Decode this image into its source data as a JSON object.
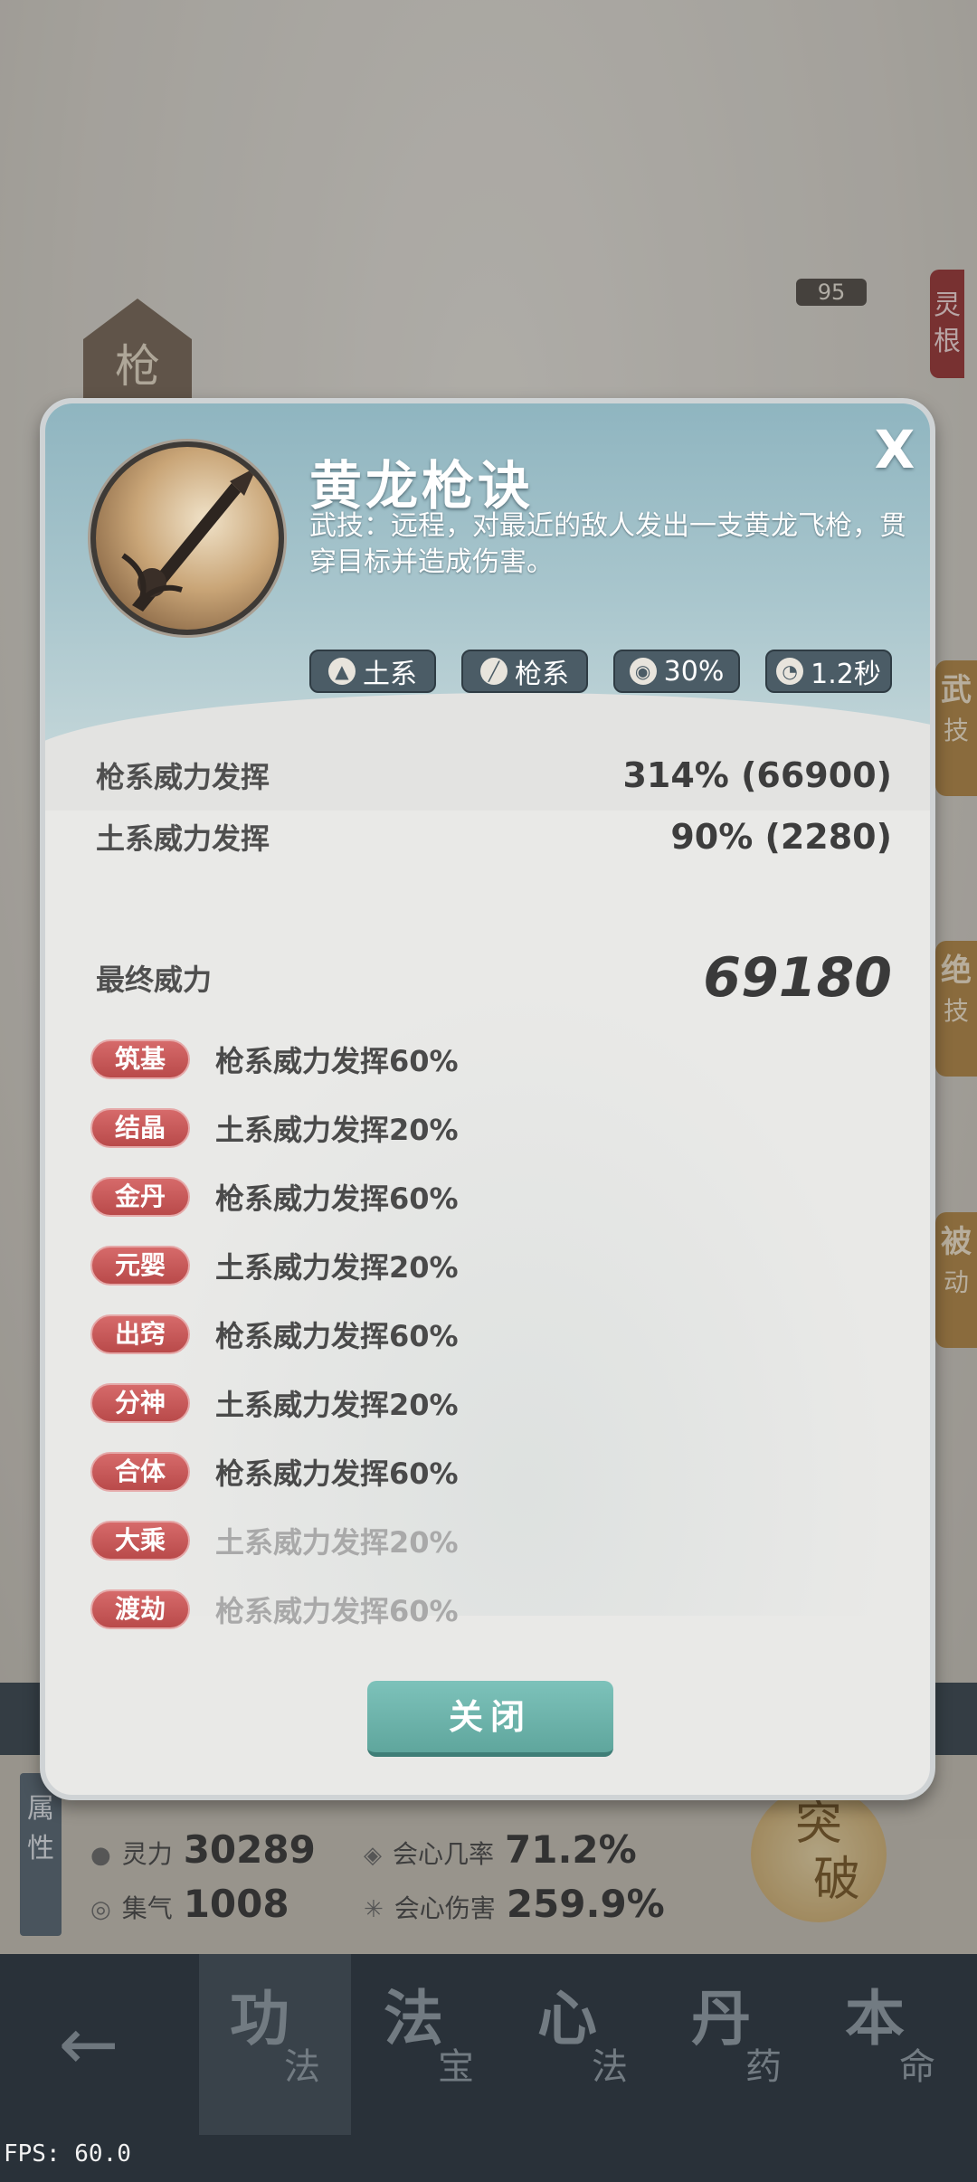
{
  "background": {
    "weapon_badge": "枪",
    "level": "95",
    "linggen": "灵根",
    "side_tabs": [
      {
        "big": "武",
        "small": "技"
      },
      {
        "big": "绝",
        "small": "技"
      },
      {
        "big": "被",
        "small": "动"
      }
    ],
    "attribute_label": "属性",
    "stats": [
      {
        "icon": "droplet-icon",
        "label": "灵力",
        "value": "30289"
      },
      {
        "icon": "swirl-icon",
        "label": "集气",
        "value": "1008"
      },
      {
        "icon": "crit-rate-icon",
        "label": "会心几率",
        "value": "71.2%"
      },
      {
        "icon": "crit-damage-icon",
        "label": "会心伤害",
        "value": "259.9%"
      }
    ],
    "breakthrough": [
      "突",
      "破"
    ],
    "nav": {
      "back": "←",
      "items": [
        {
          "big": "功",
          "small": "法"
        },
        {
          "big": "法",
          "small": "宝"
        },
        {
          "big": "心",
          "small": "法"
        },
        {
          "big": "丹",
          "small": "药"
        },
        {
          "big": "本",
          "small": "命"
        }
      ]
    },
    "fps": "FPS: 60.0"
  },
  "modal": {
    "title": "黄龙枪诀",
    "description": "武技：远程，对最近的敌人发出一支黄龙飞枪，贯穿目标并造成伤害。",
    "close_x": "X",
    "tags": [
      {
        "icon": "earth-icon",
        "label": "土系"
      },
      {
        "icon": "spear-icon",
        "label": "枪系"
      },
      {
        "icon": "spiral-icon",
        "label": "30%"
      },
      {
        "icon": "cooldown-icon",
        "label": "1.2秒"
      }
    ],
    "power_rows": [
      {
        "label": "枪系威力发挥",
        "value": "314% (66900)"
      },
      {
        "label": "土系威力发挥",
        "value": "90% (2280)"
      }
    ],
    "final_power": {
      "label": "最终威力",
      "value": "69180"
    },
    "realms": [
      {
        "realm": "筑基",
        "text": "枪系威力发挥60%",
        "unlocked": true
      },
      {
        "realm": "结晶",
        "text": "土系威力发挥20%",
        "unlocked": true
      },
      {
        "realm": "金丹",
        "text": "枪系威力发挥60%",
        "unlocked": true
      },
      {
        "realm": "元婴",
        "text": "土系威力发挥20%",
        "unlocked": true
      },
      {
        "realm": "出窍",
        "text": "枪系威力发挥60%",
        "unlocked": true
      },
      {
        "realm": "分神",
        "text": "土系威力发挥20%",
        "unlocked": true
      },
      {
        "realm": "合体",
        "text": "枪系威力发挥60%",
        "unlocked": true
      },
      {
        "realm": "大乘",
        "text": "土系威力发挥20%",
        "unlocked": false
      },
      {
        "realm": "渡劫",
        "text": "枪系威力发挥60%",
        "unlocked": false
      }
    ],
    "close_button": "关闭"
  },
  "colors": {
    "header_top": "#8fb5c0",
    "realm_pill": "#c95a5a",
    "close_button": "#6fb4ab",
    "tag_bg": "#4b5c66"
  }
}
